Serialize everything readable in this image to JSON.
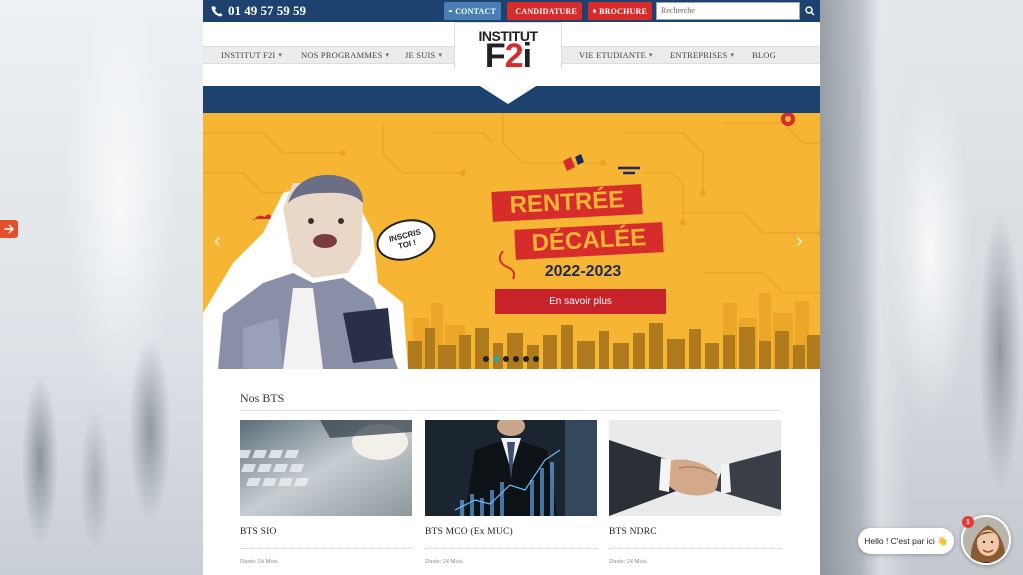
{
  "topbar": {
    "phone": "01 49 57 59 59",
    "contact_label": "CONTACT",
    "candidature_label": "CANDIDATURE",
    "brochure_label": "BROCHURE",
    "search_placeholder": "Recherche"
  },
  "logo": {
    "line1": "INSTITUT",
    "line2_a": "F",
    "line2_b": "2",
    "line2_c": "i"
  },
  "nav": {
    "items": [
      {
        "label": "INSTITUT F2I",
        "dropdown": true
      },
      {
        "label": "NOS PROGRAMMES",
        "dropdown": true
      },
      {
        "label": "JE SUIS",
        "dropdown": true
      },
      {
        "label": "VIE ETUDIANTE",
        "dropdown": true
      },
      {
        "label": "ENTREPRISES",
        "dropdown": true
      },
      {
        "label": "BLOG",
        "dropdown": false
      }
    ]
  },
  "hero": {
    "bubble": "INSCRIS\nTOI !",
    "line1": "RENTRÉE",
    "line2": "DÉCALÉE",
    "year": "2022-2023",
    "cta": "En savoir plus",
    "prev_arrow": "‹",
    "next_arrow": "›",
    "slide_count": 6,
    "active_slide": 2
  },
  "bts": {
    "title": "Nos BTS",
    "cards": [
      {
        "title": "BTS SIO",
        "meta": "Durée: 24 Mois"
      },
      {
        "title": "BTS MCO (Ex MUC)",
        "meta": "Durée: 24 Mois"
      },
      {
        "title": "BTS NDRC",
        "meta": "Durée: 24 Mois"
      }
    ]
  },
  "chat": {
    "message": "Hello ! C'est par ici 👋",
    "badge": "1"
  },
  "colors": {
    "navy": "#1e4270",
    "red": "#d62c2c",
    "yellow": "#f6b633",
    "teal": "#25a7b0"
  }
}
